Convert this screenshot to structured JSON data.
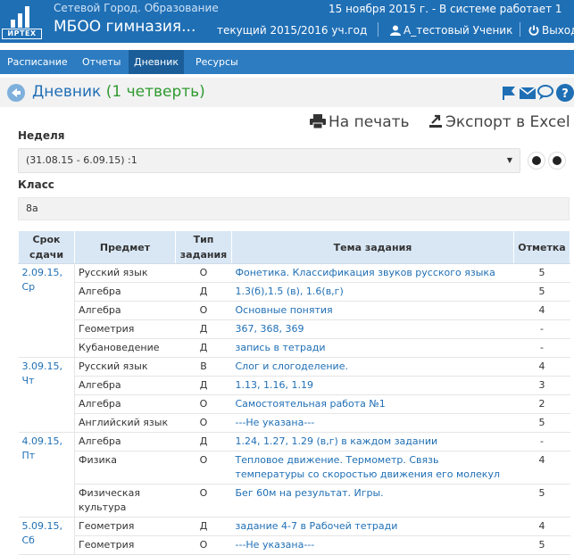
{
  "header": {
    "logo_text": "ИРТЕХ",
    "app_name": "Сетевой Город. Образование",
    "school_name": "МБОО гимназия...",
    "date_info": "15 ноября 2015 г. - В системе работает 1",
    "year_info": "текущий 2015/2016 уч.год",
    "user_name": "А_тестовый Ученик",
    "exit_label": "Выход"
  },
  "nav": {
    "items": [
      {
        "label": "Расписание"
      },
      {
        "label": "Отчеты"
      },
      {
        "label": "Дневник"
      },
      {
        "label": "Ресурсы"
      }
    ],
    "active": "Дневник"
  },
  "page": {
    "title": "Дневник",
    "quarter": "(1 четверть)"
  },
  "actions": {
    "print_label": "На печать",
    "export_label": "Экспорт в Excel"
  },
  "filters": {
    "week_label": "Неделя",
    "week_value": "(31.08.15 - 6.09.15) :1",
    "class_label": "Класс",
    "class_value": "8а"
  },
  "table": {
    "headers": [
      "Срок сдачи",
      "Предмет",
      "Тип задания",
      "Тема задания",
      "Отметка"
    ],
    "groups": [
      {
        "date": "2.09.15, Ср",
        "rows": [
          {
            "subject": "Русский язык",
            "type": "О",
            "topic": "Фонетика. Классификация звуков русского языка",
            "mark": "5"
          },
          {
            "subject": "Алгебра",
            "type": "Д",
            "topic": "1.3(б),1.5 (в), 1.6(в,г)",
            "mark": "5"
          },
          {
            "subject": "Алгебра",
            "type": "О",
            "topic": "Основные понятия",
            "mark": "4"
          },
          {
            "subject": "Геометрия",
            "type": "Д",
            "topic": "367, 368, 369",
            "mark": "-"
          },
          {
            "subject": "Кубановедение",
            "type": "Д",
            "topic": "запись в тетради",
            "mark": "-"
          }
        ]
      },
      {
        "date": "3.09.15, Чт",
        "rows": [
          {
            "subject": "Русский язык",
            "type": "В",
            "topic": "Слог и слогоделение.",
            "mark": "4"
          },
          {
            "subject": "Алгебра",
            "type": "Д",
            "topic": "1.13, 1.16, 1.19",
            "mark": "3"
          },
          {
            "subject": "Алгебра",
            "type": "О",
            "topic": "Самостоятельная работа №1",
            "mark": "2"
          },
          {
            "subject": "Английский язык",
            "type": "О",
            "topic": "---Не указана---",
            "mark": "5"
          }
        ]
      },
      {
        "date": "4.09.15, Пт",
        "rows": [
          {
            "subject": "Алгебра",
            "type": "Д",
            "topic": "1.24, 1.27, 1.29 (в,г) в каждом задании",
            "mark": "-"
          },
          {
            "subject": "Физика",
            "type": "О",
            "topic": "Тепловое движение. Термометр. Связь температуры со скоростью движения его молекул",
            "mark": "4"
          },
          {
            "subject": "Физическая культура",
            "type": "О",
            "topic": "Бег 60м на результат. Игры.",
            "mark": "5"
          }
        ]
      },
      {
        "date": "5.09.15, Сб",
        "rows": [
          {
            "subject": "Геометрия",
            "type": "Д",
            "topic": "задание 4-7 в Рабочей тетради",
            "mark": "4"
          },
          {
            "subject": "Геометрия",
            "type": "О",
            "topic": "---Не указана---",
            "mark": "5"
          }
        ]
      }
    ]
  },
  "colors": {
    "header_bg": "#1f6fb5",
    "nav_bg": "#2d7cc1",
    "nav_active": "#1a5d99",
    "link": "#1f6fb5",
    "quarter": "#2f9a2f",
    "table_header": "#d9e7f5"
  },
  "icons": {
    "back": "back-arrow-icon",
    "flag": "flag-icon",
    "mail": "mail-icon",
    "chat": "chat-icon",
    "help": "help-icon",
    "print": "printer-icon",
    "export": "export-icon",
    "user": "user-icon",
    "power": "power-icon"
  }
}
